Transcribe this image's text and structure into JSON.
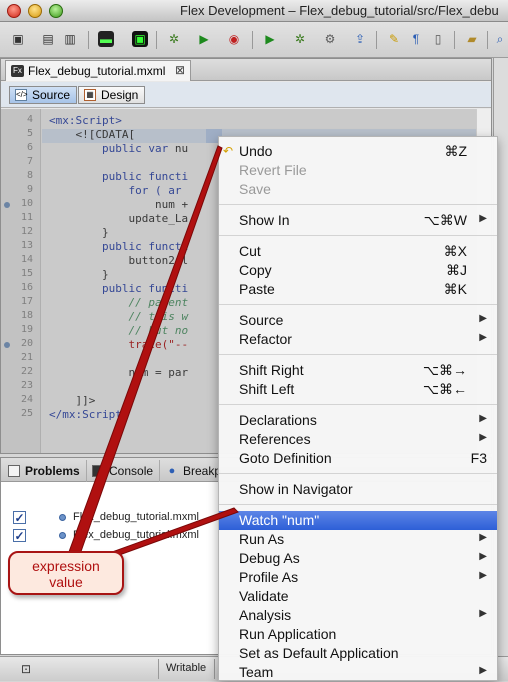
{
  "window": {
    "title": "Flex Development – Flex_debug_tutorial/src/Flex_debu"
  },
  "editor": {
    "tab_label": "Flex_debug_tutorial.mxml",
    "tab_close": "⊠",
    "modes": {
      "source": "Source",
      "design": "Design"
    },
    "line_numbers": [
      "4",
      "5",
      "6",
      "7",
      "8",
      "9",
      "10",
      "11",
      "12",
      "13",
      "14",
      "15",
      "16",
      "17",
      "18",
      "19",
      "20",
      "21",
      "22",
      "23",
      "24",
      "25"
    ],
    "breakpoint_lines": [
      "10",
      "20"
    ],
    "code": {
      "l4": "<mx:Script>",
      "l5": "    <![CDATA[",
      "l6_kw": "        public var ",
      "l6_var": "nu",
      "l8_kw": "        public functi",
      "l9": "            for ( ar",
      "l10": "                num +",
      "l11": "            update_La",
      "l12": "        }",
      "l13_kw": "        public functi",
      "l14": "            button2.l",
      "l15": "        }",
      "l16_kw": "        public functi",
      "l17": "            // parent",
      "l18": "            // this w",
      "l19": "            // but no",
      "l20_fn": "            trace",
      "l20_str": "(\"--",
      "l22": "            num = par",
      "l24": "    ]]>",
      "l25": "</mx:Script>"
    }
  },
  "bottom_panel": {
    "tabs": {
      "problems": "Problems",
      "console": "Console",
      "breakpoints": "Breakp"
    },
    "rows": [
      {
        "checked": true,
        "label": "Flex_debug_tutorial.mxml"
      },
      {
        "checked": true,
        "label": "Flex_debug_tutorial.mxml"
      }
    ]
  },
  "status_bar": {
    "writable": "Writable"
  },
  "context_menu": {
    "undo": {
      "label": "Undo",
      "shortcut": "⌘Z"
    },
    "revert": {
      "label": "Revert File"
    },
    "save": {
      "label": "Save"
    },
    "show_in": {
      "label": "Show In",
      "shortcut": "⌥⌘W"
    },
    "cut": {
      "label": "Cut",
      "shortcut": "⌘X"
    },
    "copy": {
      "label": "Copy",
      "shortcut": "⌘J"
    },
    "paste": {
      "label": "Paste",
      "shortcut": "⌘K"
    },
    "source": {
      "label": "Source"
    },
    "refactor": {
      "label": "Refactor"
    },
    "shift_right": {
      "label": "Shift Right",
      "shortcut": "⌥⌘→"
    },
    "shift_left": {
      "label": "Shift Left",
      "shortcut": "⌥⌘←"
    },
    "declarations": {
      "label": "Declarations"
    },
    "references": {
      "label": "References"
    },
    "goto_definition": {
      "label": "Goto Definition",
      "shortcut": "F3"
    },
    "show_in_navigator": {
      "label": "Show in Navigator"
    },
    "watch": {
      "label": "Watch \"num\""
    },
    "run_as": {
      "label": "Run As"
    },
    "debug_as": {
      "label": "Debug As"
    },
    "profile_as": {
      "label": "Profile As"
    },
    "validate": {
      "label": "Validate"
    },
    "analysis": {
      "label": "Analysis"
    },
    "run_application": {
      "label": "Run Application"
    },
    "set_default": {
      "label": "Set as Default Application"
    },
    "team": {
      "label": "Team"
    }
  },
  "callout": {
    "line1": "expression",
    "line2": "value"
  },
  "colors": {
    "highlight": "#2d5fd7",
    "callout_border": "#a81414",
    "arrow": "#b01010"
  }
}
